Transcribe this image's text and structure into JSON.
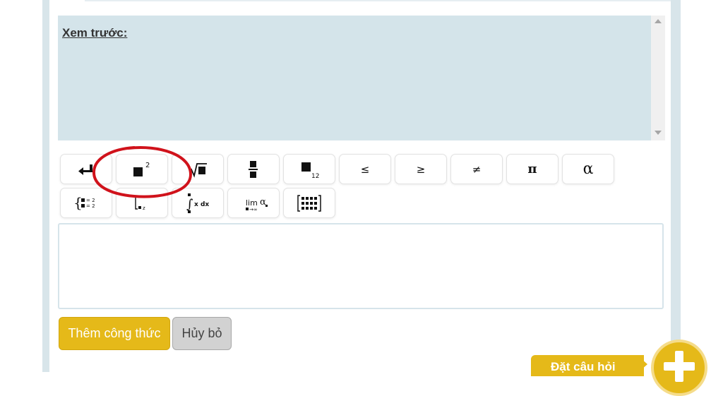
{
  "preview": {
    "label": "Xem trước:"
  },
  "toolbar": {
    "row1": [
      {
        "name": "newline-button",
        "icon": "return-arrow-icon"
      },
      {
        "name": "superscript-button",
        "icon": "superscript-icon",
        "text": "2"
      },
      {
        "name": "sqrt-button",
        "icon": "square-root-icon"
      },
      {
        "name": "fraction-button",
        "icon": "fraction-icon"
      },
      {
        "name": "subscript-button",
        "icon": "subscript-icon",
        "text": "12"
      },
      {
        "name": "less-equal-button",
        "text": "≤"
      },
      {
        "name": "greater-equal-button",
        "text": "≥"
      },
      {
        "name": "not-equal-button",
        "text": "≠"
      },
      {
        "name": "pi-button",
        "text": "π"
      },
      {
        "name": "alpha-button",
        "text": "α"
      }
    ],
    "row2": [
      {
        "name": "system-of-equations-button",
        "icon": "system-of-equations-icon",
        "text": "= 2"
      },
      {
        "name": "bracket-subscript-button",
        "icon": "bracket-icon",
        "text": "z"
      },
      {
        "name": "integral-button",
        "icon": "integral-icon",
        "text": "x dx"
      },
      {
        "name": "limit-button",
        "icon": "limit-icon",
        "text": "lim",
        "sub": "→∞",
        "greek": "α"
      },
      {
        "name": "matrix-button",
        "icon": "matrix-icon"
      }
    ]
  },
  "actions": {
    "add_formula": "Thêm công thức",
    "cancel": "Hủy bỏ"
  },
  "ask_question": {
    "label": "Đặt câu hỏi",
    "icon": "plus-icon"
  },
  "colors": {
    "accent": "#e5b919",
    "preview_bg": "#d4e4ea",
    "annotation": "#d0121b"
  }
}
